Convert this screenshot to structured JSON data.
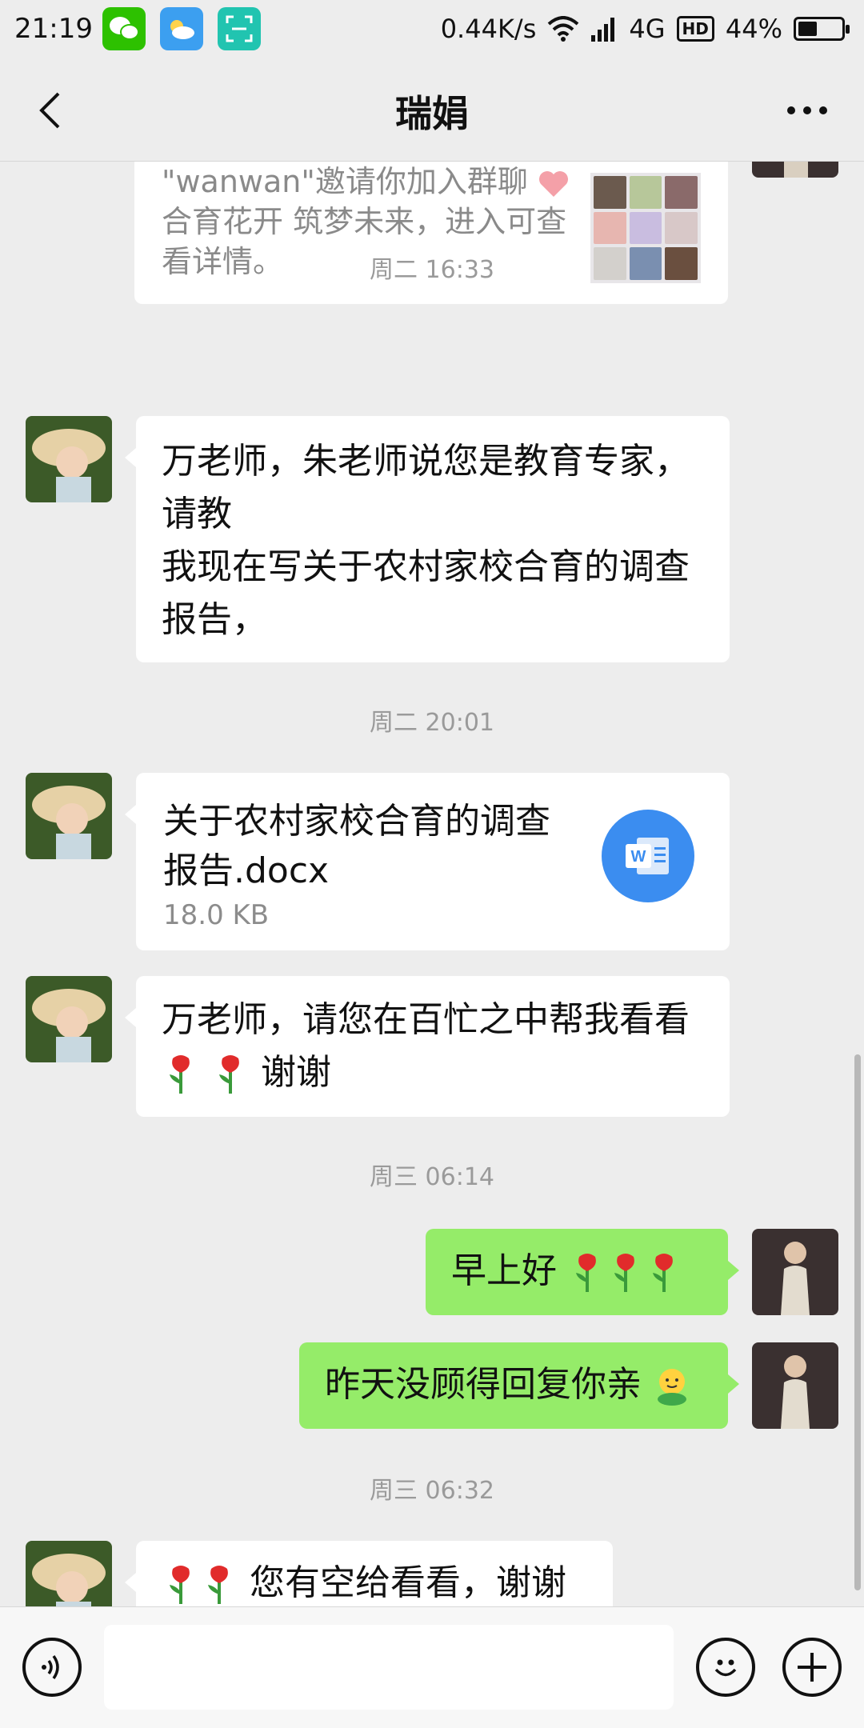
{
  "status_bar": {
    "time": "21:19",
    "network_speed": "0.44K/s",
    "network_type": "4G",
    "hd_label": "HD",
    "battery_percent": "44%",
    "battery_level": 0.44
  },
  "header": {
    "title": "瑞娟",
    "back_icon": "chevron-left-icon",
    "more_icon": "more-icon"
  },
  "group_invite": {
    "line1": "\"wanwan\"邀请你加入群聊",
    "line2": "合育花开 筑梦未来，进入可查",
    "line3": "看详情。"
  },
  "messages": [
    {
      "type": "timestamp",
      "text": "周二 16:33"
    },
    {
      "type": "text",
      "from": "other",
      "lines": [
        "万老师，朱老师说您是教育专家，",
        "请教",
        "我现在写关于农村家校合育的调查",
        "报告，"
      ]
    },
    {
      "type": "timestamp",
      "text": "周二 20:01"
    },
    {
      "type": "file",
      "from": "other",
      "title_lines": [
        "关于农村家校合育的调查",
        "报告.docx"
      ],
      "size": "18.0 KB",
      "icon": "word-doc-icon"
    },
    {
      "type": "text",
      "from": "other",
      "lines": [
        "万老师，请您在百忙之中帮我看看",
        "谢谢"
      ]
    },
    {
      "type": "timestamp",
      "text": "周三 06:14"
    },
    {
      "type": "text",
      "from": "me",
      "text": "早上好"
    },
    {
      "type": "text",
      "from": "me",
      "text": "昨天没顾得回复你亲"
    },
    {
      "type": "timestamp",
      "text": "周三 06:32"
    },
    {
      "type": "text",
      "from": "other",
      "text": "您有空给看看，谢谢"
    }
  ],
  "input_bar": {
    "voice_icon": "voice-icon",
    "emoji_icon": "emoji-icon",
    "plus_icon": "plus-icon",
    "input_value": ""
  },
  "colors": {
    "background": "#ededed",
    "my_bubble": "#95ec69",
    "other_bubble": "#ffffff",
    "timestamp": "#9a9a9a"
  }
}
